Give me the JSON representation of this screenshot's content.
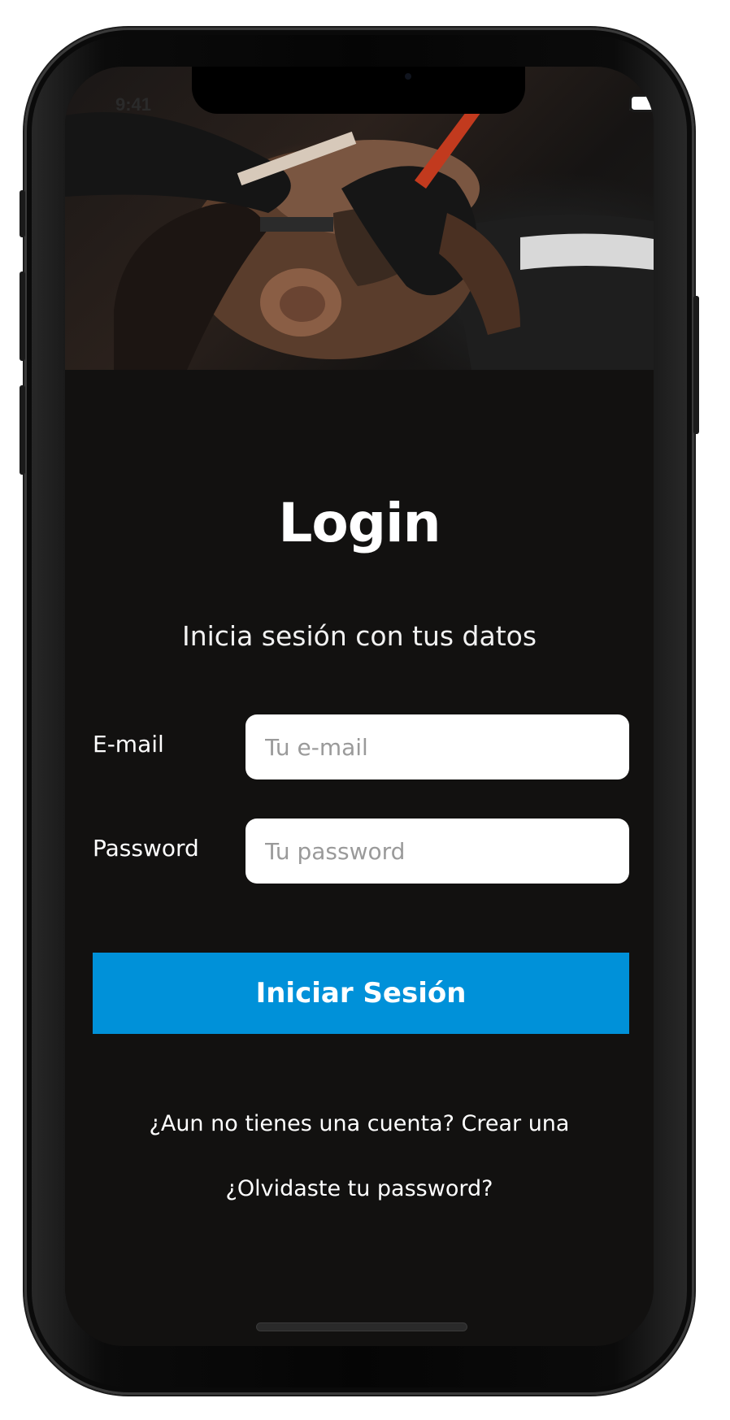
{
  "status_bar": {
    "time": "9:41",
    "icons": [
      "signal-bars-icon",
      "wifi-icon",
      "battery-icon"
    ]
  },
  "login": {
    "title": "Login",
    "subtitle": "Inicia sesión con tus datos",
    "email": {
      "label": "E-mail",
      "placeholder": "Tu e-mail",
      "value": ""
    },
    "password": {
      "label": "Password",
      "placeholder": "Tu password",
      "value": ""
    },
    "submit_label": "Iniciar Sesión",
    "create_account_link": "¿Aun no tienes una cuenta? Crear una",
    "forgot_password_link": "¿Olvidaste tu password?"
  },
  "colors": {
    "background": "#121110",
    "button": "#0091d9",
    "text": "#ffffff",
    "input_background": "#ffffff",
    "placeholder": "#9a9a9a"
  }
}
